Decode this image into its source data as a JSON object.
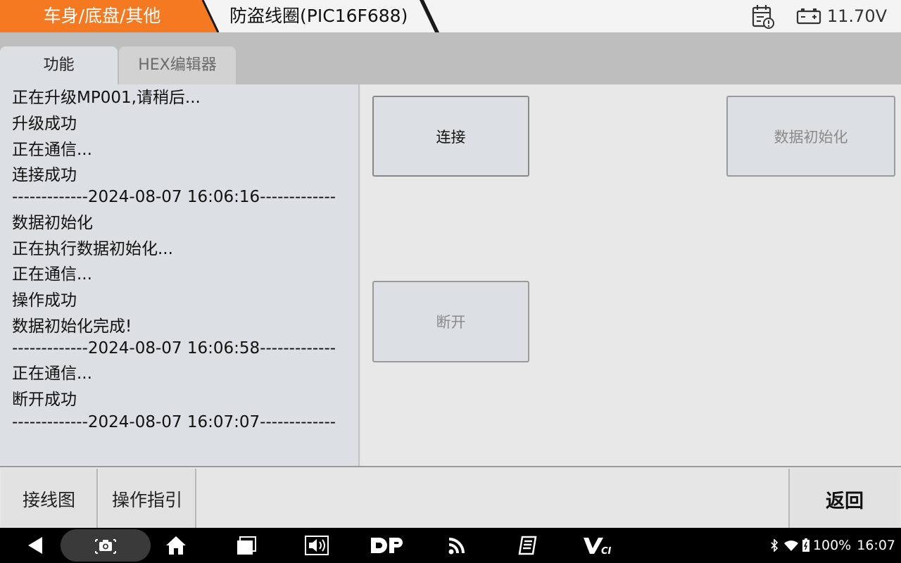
{
  "header": {
    "breadcrumb_category": "车身/底盘/其他",
    "breadcrumb_module": "防盗线圈(PIC16F688)",
    "voltage": "11.70V",
    "accent_color": "#f47920"
  },
  "tabs": [
    {
      "label": "功能",
      "active": true
    },
    {
      "label": "HEX编辑器",
      "active": false
    }
  ],
  "log_lines": [
    "正在升级MP001,请稍后...",
    "升级成功",
    "正在通信...",
    "连接成功",
    "-------------2024-08-07 16:06:16-------------",
    "数据初始化",
    "正在执行数据初始化...",
    "正在通信...",
    "操作成功",
    "数据初始化完成!",
    "-------------2024-08-07 16:06:58-------------",
    "正在通信...",
    "断开成功",
    "-------------2024-08-07 16:07:07-------------"
  ],
  "actions": {
    "connect": {
      "label": "连接",
      "enabled": true
    },
    "data_init": {
      "label": "数据初始化",
      "enabled": false
    },
    "disconnect": {
      "label": "断开",
      "enabled": false
    }
  },
  "toolbar": {
    "wiring_label": "接线图",
    "guide_label": "操作指引",
    "back_label": "返回"
  },
  "navbar": {
    "icons": [
      "back-icon",
      "screenshot-icon",
      "home-icon",
      "recent-apps-icon",
      "volume-icon",
      "dp-icon",
      "feed-icon",
      "notes-icon",
      "vci-icon"
    ]
  },
  "status_bar": {
    "battery": "100%",
    "time": "16:07"
  }
}
